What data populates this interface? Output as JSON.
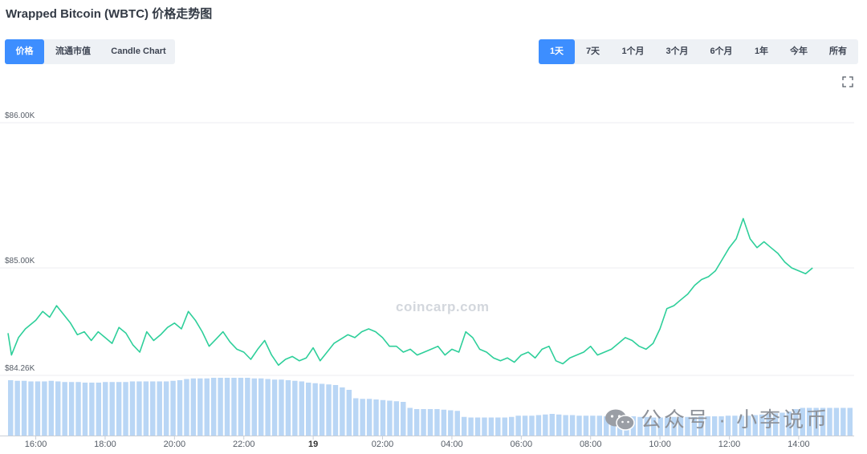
{
  "title": "Wrapped Bitcoin (WBTC) 价格走势图",
  "left_tabs": [
    {
      "label": "价格",
      "active": true
    },
    {
      "label": "流通市值",
      "active": false
    },
    {
      "label": "Candle Chart",
      "active": false
    }
  ],
  "range_tabs": [
    {
      "label": "1天",
      "active": true
    },
    {
      "label": "7天",
      "active": false
    },
    {
      "label": "1个月",
      "active": false
    },
    {
      "label": "3个月",
      "active": false
    },
    {
      "label": "6个月",
      "active": false
    },
    {
      "label": "1年",
      "active": false
    },
    {
      "label": "今年",
      "active": false
    },
    {
      "label": "所有",
      "active": false
    }
  ],
  "watermark": "coincarp.com",
  "wechat_watermark": "公众号 · 小李说币",
  "colors": {
    "line": "#2ecf9a",
    "volume": "#b9d6f5",
    "accent": "#3d8eff",
    "grid": "#eceef1"
  },
  "chart_data": {
    "type": "line",
    "y_ticks": [
      {
        "value": 86000,
        "label": "$86.00K"
      },
      {
        "value": 85000,
        "label": "$85.00K"
      },
      {
        "value": 84260,
        "label": "$84.26K"
      }
    ],
    "x_ticks": [
      {
        "value": 16,
        "label": "16:00",
        "bold": false
      },
      {
        "value": 18,
        "label": "18:00",
        "bold": false
      },
      {
        "value": 20,
        "label": "20:00",
        "bold": false
      },
      {
        "value": 22,
        "label": "22:00",
        "bold": false
      },
      {
        "value": 24,
        "label": "19",
        "bold": true
      },
      {
        "value": 26,
        "label": "02:00",
        "bold": false
      },
      {
        "value": 28,
        "label": "04:00",
        "bold": false
      },
      {
        "value": 30,
        "label": "06:00",
        "bold": false
      },
      {
        "value": 32,
        "label": "08:00",
        "bold": false
      },
      {
        "value": 34,
        "label": "10:00",
        "bold": false
      },
      {
        "value": 36,
        "label": "12:00",
        "bold": false
      },
      {
        "value": 38,
        "label": "14:00",
        "bold": false
      }
    ],
    "xlim": [
      15.2,
      39.6
    ],
    "price": {
      "x": [
        15.2,
        15.3,
        15.5,
        15.7,
        16.0,
        16.2,
        16.4,
        16.6,
        16.8,
        17.0,
        17.2,
        17.4,
        17.6,
        17.8,
        18.0,
        18.2,
        18.4,
        18.6,
        18.8,
        19.0,
        19.2,
        19.4,
        19.6,
        19.8,
        20.0,
        20.2,
        20.4,
        20.6,
        20.8,
        21.0,
        21.2,
        21.4,
        21.6,
        21.8,
        22.0,
        22.2,
        22.4,
        22.6,
        22.8,
        23.0,
        23.2,
        23.4,
        23.6,
        23.8,
        24.0,
        24.2,
        24.4,
        24.6,
        24.8,
        25.0,
        25.2,
        25.4,
        25.6,
        25.8,
        26.0,
        26.2,
        26.4,
        26.6,
        26.8,
        27.0,
        27.2,
        27.4,
        27.6,
        27.8,
        28.0,
        28.2,
        28.4,
        28.6,
        28.8,
        29.0,
        29.2,
        29.4,
        29.6,
        29.8,
        30.0,
        30.2,
        30.4,
        30.6,
        30.8,
        31.0,
        31.2,
        31.4,
        31.6,
        31.8,
        32.0,
        32.2,
        32.4,
        32.6,
        32.8,
        33.0,
        33.2,
        33.4,
        33.6,
        33.8,
        34.0,
        34.2,
        34.4,
        34.6,
        34.8,
        35.0,
        35.2,
        35.4,
        35.6,
        35.8,
        36.0,
        36.2,
        36.4,
        36.6,
        36.8,
        37.0,
        37.2,
        37.4,
        37.6,
        37.8,
        38.0,
        38.2,
        38.4,
        38.6,
        38.8,
        39.0,
        39.2,
        39.4,
        39.6
      ],
      "y": [
        84550,
        84400,
        84520,
        84580,
        84640,
        84700,
        84660,
        84740,
        84680,
        84620,
        84540,
        84560,
        84500,
        84560,
        84520,
        84480,
        84590,
        84550,
        84470,
        84420,
        84560,
        84500,
        84540,
        84590,
        84620,
        84580,
        84700,
        84640,
        84560,
        84460,
        84510,
        84560,
        84490,
        84440,
        84420,
        84370,
        84440,
        84500,
        84400,
        84330,
        84370,
        84390,
        84360,
        84380,
        84450,
        84360,
        84420,
        84480,
        84510,
        84540,
        84520,
        84560,
        84580,
        84560,
        84520,
        84460,
        84460,
        84420,
        84440,
        84400,
        84420,
        84440,
        84460,
        84400,
        84440,
        84420,
        84560,
        84520,
        84440,
        84420,
        84380,
        84360,
        84380,
        84350,
        84400,
        84420,
        84380,
        84440,
        84460,
        84360,
        84340,
        84380,
        84400,
        84420,
        84460,
        84400,
        84420,
        84440,
        84480,
        84520,
        84500,
        84460,
        84440,
        84480,
        84580,
        84720,
        84740,
        84780,
        84820,
        84880,
        84920,
        84940,
        84980,
        85060,
        85140,
        85200,
        85340,
        85200,
        85140,
        85180,
        85140,
        85100,
        85040,
        85000,
        84980,
        84960,
        85000
      ]
    },
    "volume_relative": [
      0.92,
      0.91,
      0.91,
      0.9,
      0.9,
      0.9,
      0.91,
      0.9,
      0.89,
      0.89,
      0.89,
      0.88,
      0.88,
      0.88,
      0.89,
      0.89,
      0.89,
      0.89,
      0.9,
      0.9,
      0.9,
      0.9,
      0.9,
      0.9,
      0.91,
      0.92,
      0.94,
      0.95,
      0.95,
      0.95,
      0.96,
      0.96,
      0.96,
      0.96,
      0.96,
      0.96,
      0.95,
      0.95,
      0.94,
      0.93,
      0.93,
      0.92,
      0.91,
      0.9,
      0.88,
      0.87,
      0.86,
      0.85,
      0.84,
      0.8,
      0.76,
      0.62,
      0.61,
      0.61,
      0.6,
      0.59,
      0.58,
      0.57,
      0.56,
      0.46,
      0.44,
      0.44,
      0.44,
      0.44,
      0.43,
      0.42,
      0.41,
      0.31,
      0.3,
      0.3,
      0.3,
      0.3,
      0.3,
      0.3,
      0.31,
      0.33,
      0.33,
      0.33,
      0.34,
      0.35,
      0.36,
      0.35,
      0.34,
      0.34,
      0.33,
      0.33,
      0.33,
      0.33,
      0.32,
      0.32,
      0.32,
      0.32,
      0.32,
      0.31,
      0.31,
      0.3,
      0.3,
      0.3,
      0.31,
      0.31,
      0.31,
      0.31,
      0.32,
      0.32,
      0.32,
      0.32,
      0.33,
      0.33,
      0.33,
      0.33,
      0.34,
      0.35,
      0.36,
      0.37,
      0.38,
      0.4,
      0.44,
      0.46,
      0.46,
      0.46,
      0.46,
      0.46,
      0.46,
      0.46,
      0.46
    ]
  }
}
